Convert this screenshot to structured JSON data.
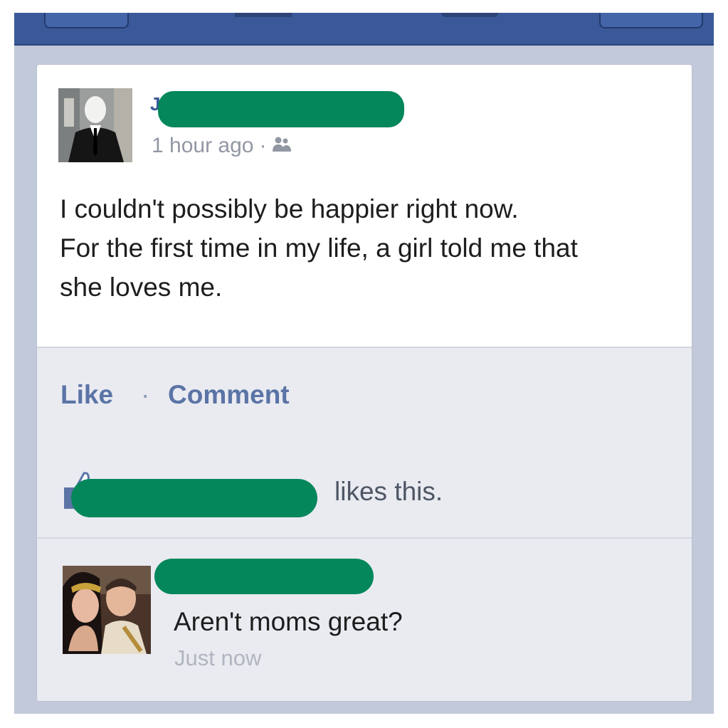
{
  "post": {
    "author_initial": "J",
    "time": "1 hour ago",
    "separator": "·",
    "privacy_icon": "friends-icon",
    "text": [
      "I couldn't possibly be happier right now.",
      "For the first time in my life, a girl told me that",
      "she loves me."
    ]
  },
  "actions": {
    "like_label": "Like",
    "separator": "·",
    "comment_label": "Comment"
  },
  "likes": {
    "icon": "thumbs-up-icon",
    "text": "likes this."
  },
  "comment": {
    "text": "Aren't moms great?",
    "time": "Just now"
  },
  "colors": {
    "brand_blue": "#3b5998",
    "action_blue": "#5b74a6",
    "redaction_green": "#04875a",
    "panel_bg": "#e9ebf1"
  }
}
